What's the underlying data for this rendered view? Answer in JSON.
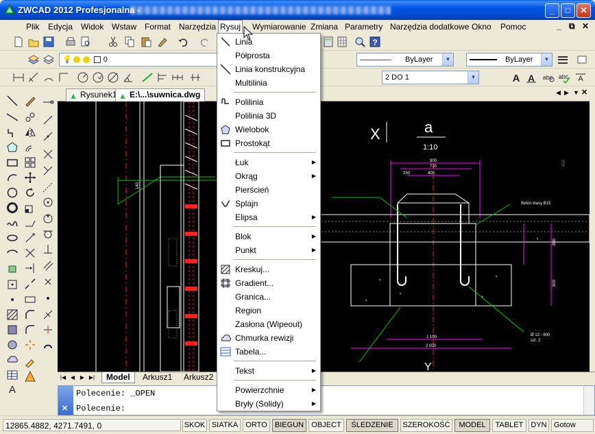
{
  "window": {
    "title": "ZWCAD 2012 Profesjonalna - ",
    "minimize": "_",
    "maximize": "□",
    "close": "✕"
  },
  "menubar": {
    "items": [
      "Plik",
      "Edycja",
      "Widok",
      "Wstaw",
      "Format",
      "Narzędzia",
      "Rysuj",
      "Wymiarowanie",
      "Zmiana",
      "Parametry",
      "Narzędzia dodatkowe",
      "Okno",
      "Pomoc"
    ],
    "active": "Rysuj"
  },
  "toolbar": {
    "layer_value": "0",
    "color_value": "ByLayer",
    "linetype_value": "ByLayer",
    "dimstyle_value": "2 DO 1"
  },
  "draw_menu": {
    "items": [
      {
        "label": "Linia",
        "icon": "line-icon"
      },
      {
        "label": "Półprosta",
        "icon": ""
      },
      {
        "label": "Linia konstrukcyjna",
        "icon": "xline-icon"
      },
      {
        "label": "Multilinia",
        "icon": ""
      },
      {
        "label": "Polilinia",
        "icon": "polyline-icon"
      },
      {
        "label": "Polilinia 3D",
        "icon": ""
      },
      {
        "label": "Wielobok",
        "icon": "polygon-icon"
      },
      {
        "label": "Prostokąt",
        "icon": "rectangle-icon"
      },
      {
        "label": "Łuk",
        "icon": "",
        "submenu": true
      },
      {
        "label": "Okrąg",
        "icon": "",
        "submenu": true
      },
      {
        "label": "Pierścień",
        "icon": ""
      },
      {
        "label": "Splajn",
        "icon": "spline-icon"
      },
      {
        "label": "Elipsa",
        "icon": "",
        "submenu": true
      },
      {
        "label": "Blok",
        "icon": "",
        "submenu": true
      },
      {
        "label": "Punkt",
        "icon": "",
        "submenu": true
      },
      {
        "label": "Kreskuj...",
        "icon": "hatch-icon"
      },
      {
        "label": "Gradient...",
        "icon": "gradient-icon"
      },
      {
        "label": "Granica...",
        "icon": ""
      },
      {
        "label": "Region",
        "icon": ""
      },
      {
        "label": "Zasłona (Wipeout)",
        "icon": ""
      },
      {
        "label": "Chmurka rewizji",
        "icon": "revcloud-icon"
      },
      {
        "label": "Tabela...",
        "icon": "table-icon"
      },
      {
        "label": "Tekst",
        "icon": "",
        "submenu": true
      },
      {
        "label": "Powierzchnie",
        "icon": "",
        "submenu": true
      },
      {
        "label": "Bryły (Solidy)",
        "icon": "",
        "submenu": true
      }
    ]
  },
  "doc_tabs": [
    "Rysunek1",
    "E:\\...\\suwnica.dwg"
  ],
  "layout_tabs": [
    "Model",
    "Arkusz1",
    "Arkusz2"
  ],
  "drawing_text": {
    "section_letter": "X",
    "section_name": "a",
    "scale": "1:10",
    "bottom_label": "Y",
    "dim_1100": "1 100",
    "dim_2000": "2 000",
    "dim_900": "900",
    "dim_730": "730",
    "dim_400": "400",
    "dim_250": "250",
    "dim_850": "850",
    "dim_800": "800",
    "dim_150": "150",
    "note_beton": "Beton klasy B15",
    "note_pret": "Ø 12 - 600",
    "note_szt": "szt. 2"
  },
  "command": {
    "line1": "Polecenie: _OPEN",
    "line2": "Polecenie:"
  },
  "status": {
    "coords": "12865.4882,  4271.7491,  0",
    "buttons": [
      "SKOK",
      "SIATKA",
      "ORTO",
      "BIEGUN",
      "OBJECT",
      "ŚLEDZENIE",
      "SZEROKOŚĆ",
      "MODEL",
      "TABLET",
      "DYN",
      "Gotow"
    ],
    "active": [
      "BIEGUN",
      "ŚLEDZENIE",
      "MODEL"
    ]
  },
  "colors": {
    "drawing_bg": "#000000",
    "magenta": "#ff00ff",
    "green": "#00c800",
    "red": "#ff2020",
    "white": "#ffffff"
  }
}
